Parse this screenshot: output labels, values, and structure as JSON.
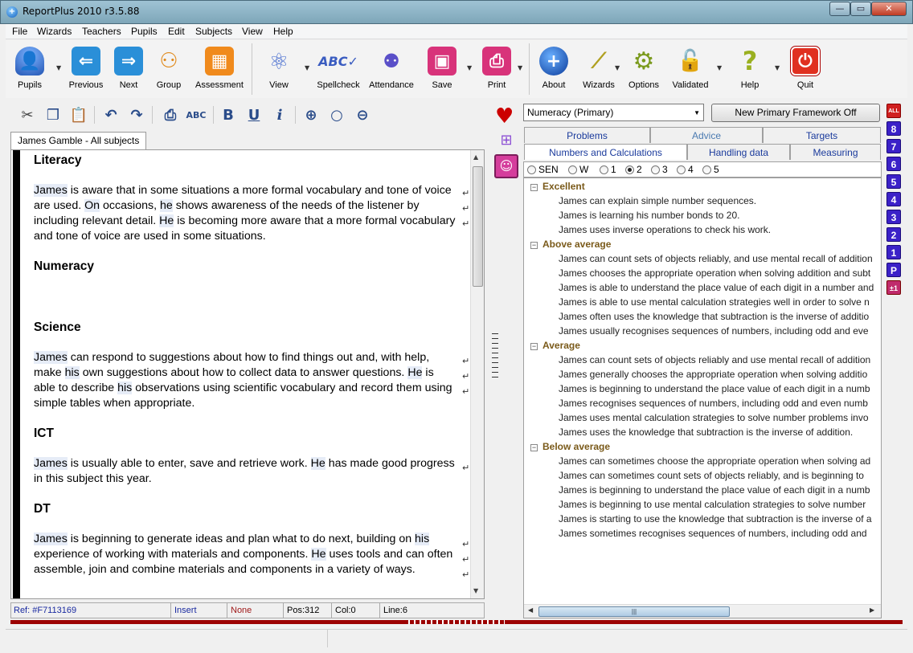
{
  "window": {
    "title": "ReportPlus 2010 r3.5.88",
    "min": "—",
    "max": "▭",
    "close": "✕"
  },
  "menu": [
    "File",
    "Wizards",
    "Teachers",
    "Pupils",
    "Edit",
    "Subjects",
    "View",
    "Help"
  ],
  "toolbar": {
    "pupils": "Pupils",
    "previous": "Previous",
    "next": "Next",
    "group": "Group",
    "assessment": "Assessment",
    "view": "View",
    "spellcheck": "Spellcheck",
    "attendance": "Attendance",
    "save": "Save",
    "print": "Print",
    "about": "About",
    "wizards": "Wizards",
    "options": "Options",
    "validated": "Validated",
    "help": "Help",
    "quit": "Quit"
  },
  "editor": {
    "tab": "James Gamble - All subjects",
    "sections": [
      {
        "heading": "Literacy"
      },
      {
        "heading": "Numeracy"
      },
      {
        "heading": "Science"
      },
      {
        "heading": "ICT"
      },
      {
        "heading": "DT"
      }
    ],
    "literacy": {
      "p1": "James",
      "p2": " is aware that in some situations a more formal vocabulary and tone of voice are used.  ",
      "p3": "On",
      "p4": " occasions, ",
      "p5": "he",
      "p6": " shows awareness of the needs of the listener by including relevant detail.  ",
      "p7": "He",
      "p8": " is becoming more aware that a more formal vocabulary and tone of voice are used in some situations."
    },
    "science": {
      "p1": "James",
      "p2": " can respond to suggestions about how to find things out and, with help, make ",
      "p3": "his",
      "p4": " own suggestions about how to collect data to answer questions.  ",
      "p5": "He",
      "p6": " is able to describe ",
      "p7": "his",
      "p8": " observations using scientific vocabulary and record them using simple tables when appropriate."
    },
    "ict": {
      "p1": "James",
      "p2": " is usually able to enter, save and retrieve work.  ",
      "p3": "He",
      "p4": " has made good progress in this subject this year."
    },
    "dt": {
      "p1": "James",
      "p2": " is beginning to generate ideas and plan what to do next, building on ",
      "p3": "his",
      "p4": " experience of working with materials and components.  ",
      "p5": "He",
      "p6": " uses tools and can often assemble, join and combine materials and components in a variety of ways."
    }
  },
  "status": {
    "ref": "Ref: #F7113169",
    "mode": "Insert",
    "style": "None",
    "pos": "Pos:312",
    "col": "Col:0",
    "line": "Line:6"
  },
  "right": {
    "subject": "Numeracy (Primary)",
    "framework_button": "New Primary Framework Off",
    "tabs_row1": [
      "Problems",
      "Advice",
      "Targets"
    ],
    "tabs_row2": [
      "Numbers and Calculations",
      "Handling data",
      "Measuring"
    ],
    "levels": [
      "SEN",
      "W",
      "1",
      "2",
      "3",
      "4",
      "5"
    ],
    "selected_level": "2",
    "groups": [
      {
        "name": "Excellent",
        "items": [
          "James can explain simple number sequences.",
          "James is learning his number bonds to 20.",
          "James uses inverse operations to check his work."
        ]
      },
      {
        "name": "Above average",
        "items": [
          "James can count sets of objects reliably, and use mental recall of addition",
          "James chooses the appropriate operation when solving addition and subt",
          "James is able to understand the place value of each digit in a number and",
          "James is able to use mental calculation strategies well in order to solve n",
          "James often uses the knowledge that subtraction is the inverse of additio",
          "James usually recognises sequences of numbers, including odd and eve"
        ]
      },
      {
        "name": "Average",
        "items": [
          "James can count sets of objects reliably and use mental recall of addition",
          "James generally chooses the appropriate operation when solving additio",
          "James is beginning to understand the place value of each digit in a numb",
          "James recognises sequences of numbers, including odd and even numb",
          "James uses mental calculation strategies to solve number problems invo",
          "James uses the knowledge that subtraction is the inverse of addition."
        ]
      },
      {
        "name": "Below average",
        "items": [
          "James can sometimes choose the appropriate operation when solving ad",
          "James can sometimes count sets of objects reliably, and is beginning to",
          "James is beginning to understand the place value of each digit in a numb",
          "James is beginning to use mental calculation strategies to solve number",
          "James is starting to use the knowledge that subtraction is the inverse of a",
          "James sometimes recognises sequences of numbers, including odd and"
        ]
      }
    ],
    "level_buttons": [
      "ALL",
      "8",
      "7",
      "6",
      "5",
      "4",
      "3",
      "2",
      "1",
      "P",
      "±1"
    ]
  }
}
